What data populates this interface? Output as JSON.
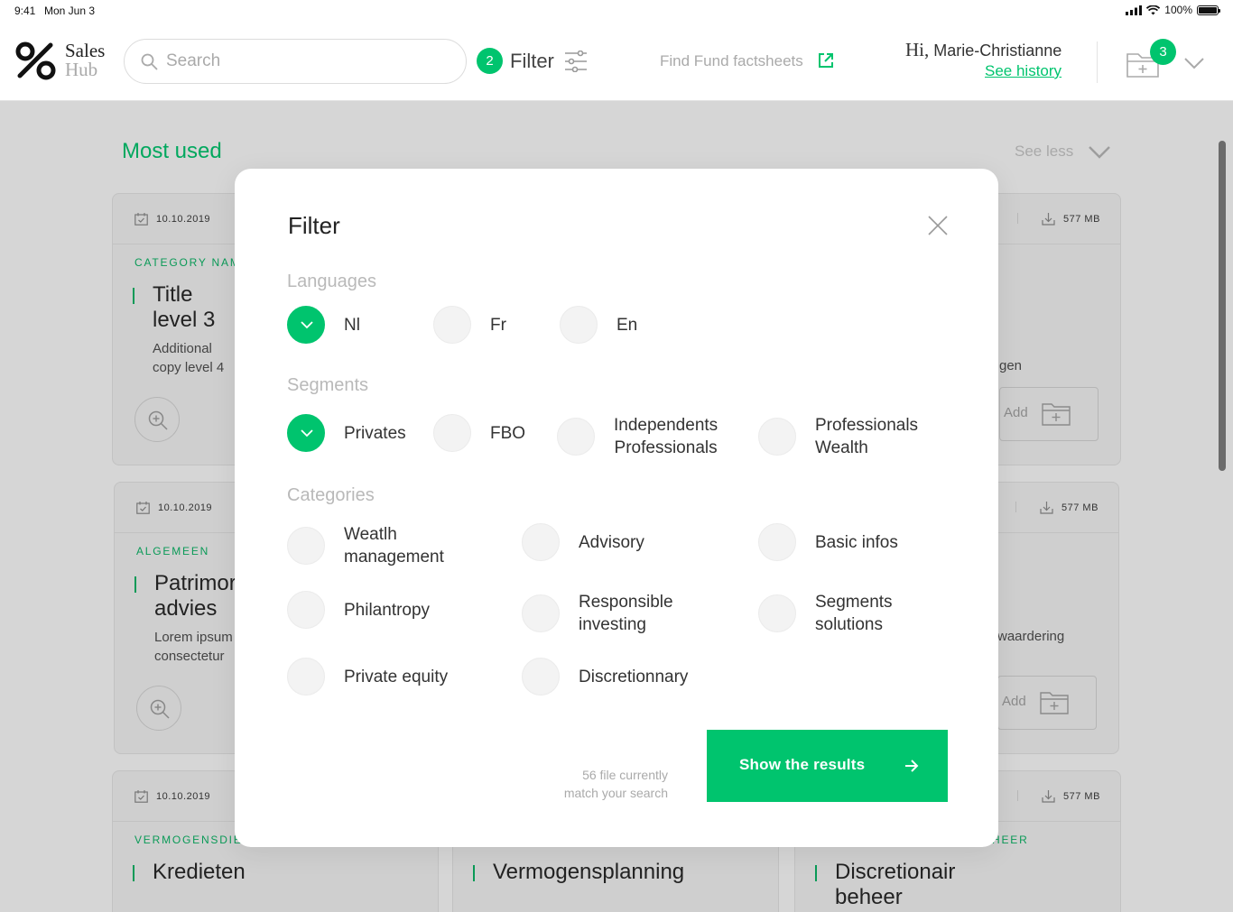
{
  "status_bar": {
    "time": "9:41",
    "date": "Mon Jun 3",
    "battery": "100%"
  },
  "header": {
    "brand_line1": "Sales",
    "brand_line2": "Hub",
    "search_placeholder": "Search",
    "filter_count": "2",
    "filter_label": "Filter",
    "factsheets_label": "Find Fund factsheets",
    "greeting_hi": "Hi,",
    "user_name": "Marie-Christianne",
    "history_link": "See history",
    "cart_count": "3"
  },
  "page": {
    "section_title": "Most used",
    "see_less": "See less",
    "cards": [
      {
        "date": "10.10.2019",
        "category": "CATEGORY NAM",
        "title": "Title level 3",
        "subtitle": "Additional copy level 4"
      },
      {
        "date": "10.10.2019",
        "category": "ALGEMEEN",
        "title": "Patrimor advies",
        "subtitle": "Lorem ipsum consectetur"
      },
      {
        "date": "10.10.2019",
        "category": "VERMOGENSDIE",
        "title": "Kredieten"
      },
      {
        "title": "Vermogensplanning"
      },
      {
        "size": "577 MB",
        "text": "gen",
        "add_label": "Add"
      },
      {
        "size": "577 MB",
        "text": "waardering",
        "add_label": "Add"
      },
      {
        "size": "577 MB",
        "category": "HEER",
        "title": "Discretionair beheer"
      }
    ]
  },
  "modal": {
    "title": "Filter",
    "languages_title": "Languages",
    "languages": [
      {
        "label": "Nl",
        "checked": true
      },
      {
        "label": "Fr",
        "checked": false
      },
      {
        "label": "En",
        "checked": false
      }
    ],
    "segments_title": "Segments",
    "segments": [
      {
        "label": "Privates",
        "checked": true
      },
      {
        "label": "FBO",
        "checked": false
      },
      {
        "label": "Independents\nProfessionals",
        "checked": false
      },
      {
        "label": "Professionals\nWealth",
        "checked": false
      }
    ],
    "categories_title": "Categories",
    "categories": [
      {
        "label": "Weatlh\nmanagement",
        "checked": false
      },
      {
        "label": "Advisory",
        "checked": false
      },
      {
        "label": "Basic infos",
        "checked": false
      },
      {
        "label": "Philantropy",
        "checked": false
      },
      {
        "label": "Responsible\ninvesting",
        "checked": false
      },
      {
        "label": "Segments\nsolutions",
        "checked": false
      },
      {
        "label": "Private equity",
        "checked": false
      },
      {
        "label": "Discretionnary",
        "checked": false
      }
    ],
    "results_note_line1": "56 file currently",
    "results_note_line2": "match your search",
    "results_button": "Show the results"
  },
  "colors": {
    "accent": "#00c46e",
    "accent_dark": "#0a9a57",
    "overlay_bg": "#d6d6d6"
  },
  "icons": [
    "search-icon",
    "filter-sliders-icon",
    "external-link-icon",
    "cart-folder-icon",
    "chevron-down-icon",
    "calendar-icon",
    "download-icon",
    "zoom-in-icon",
    "add-folder-icon",
    "close-icon",
    "check-icon",
    "arrow-right-icon"
  ]
}
